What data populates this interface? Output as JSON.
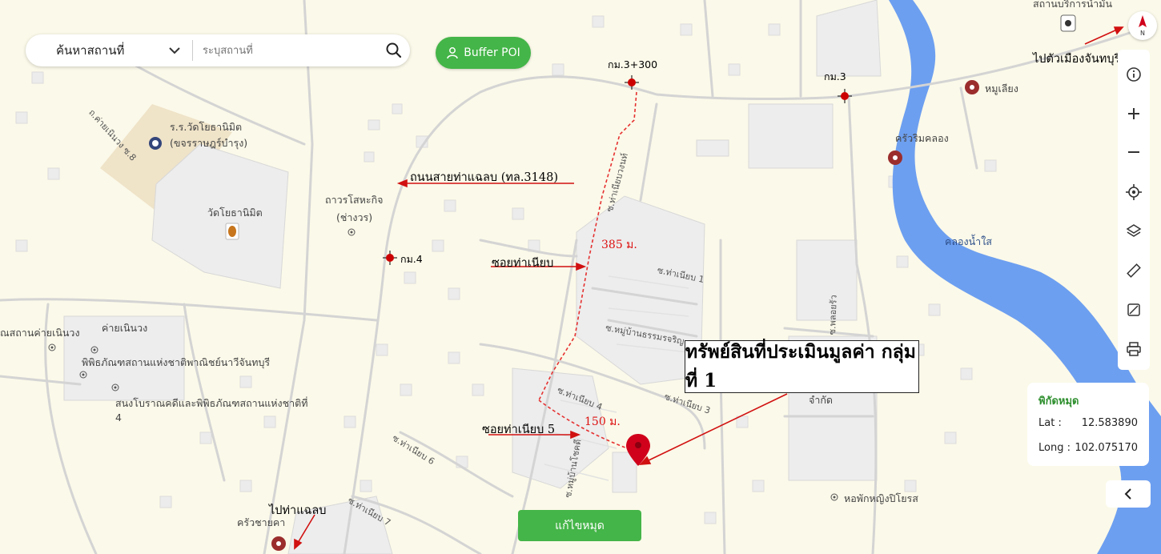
{
  "search": {
    "mode": "ค้นหาสถานที่",
    "placeholder": "ระบุสถานที่"
  },
  "buffer_button": {
    "label": "Buffer POI"
  },
  "callout": {
    "text": "ทรัพย์สินที่ประเมินมูลค่า กลุ่มที่ 1"
  },
  "annotations": {
    "main_road": "ถนนสายท่าแฉลบ (ทล.3148)",
    "soi": "ซอยท่าเนียบ",
    "soi5": "ซอยท่าเนียบ 5",
    "dist_385": "385 ม.",
    "dist_150": "150 ม.",
    "to_chanthaburi": "ไปตัวเมืองจันทบุรี",
    "to_thachalaep": "ไปท่าแฉลบ"
  },
  "km_markers": {
    "km3_300": "กม.3+300",
    "km3": "กม.3",
    "km4": "กม.4"
  },
  "places": {
    "school": "ร.ร.วัดโยธานิมิต",
    "school_sub": "(ขจรราษฎร์บำรุง)",
    "temple": "วัดโยธานิมิต",
    "thaworn": "ถาวรโสหะกิจ",
    "thaworn_sub": "(ช่างวร)",
    "camp": "ค่ายเนินวง",
    "camp_office": "ณสถานค่ายเนินวง",
    "museum": "พิพิธภัณฑสถานแห่งชาติพาณิชย์นาวีจันทบุรี",
    "archaeology": "สนงโบราณคดีและพิพิธภัณฑสถานแห่งชาติที่",
    "archaeology_num": "4",
    "noodle": "หมูเลียง",
    "riverside": "ครัวริมคลอง",
    "canal": "คลองน้ำใส",
    "company": "จำกัด",
    "dorm": "หอพักหญิงปิโยรส",
    "krua": "ครัวชายคา",
    "top_right": "สถานบริการน้ำมัน"
  },
  "roads": {
    "r1": "ถ.ค่ายเนินวง ซ.8",
    "r2": "ซ.ท่าเนียบ 1",
    "r3": "ซ.หมู่บ้านธรรมรจริญ",
    "r4": "ซ.ท่าเนียบ 4",
    "r5": "ซ.ท่าเนียบ 3",
    "r6": "ซ.ท่าเนียบ 6",
    "r7": "ซ.หมู่บ้านโชคดี",
    "r8": "ซ.ท่าเนียบ 7",
    "r9": "ซ.พลอยรัว",
    "r10": "ซ.ท่าเนียบวงนท์"
  },
  "coords": {
    "title": "พิกัดหมุด",
    "lat_label": "Lat :",
    "lat": "12.583890",
    "long_label": "Long :",
    "long": "102.075170"
  },
  "edit_button": {
    "label": "แก้ไขหมุด"
  },
  "colors": {
    "accent_green": "#44b548",
    "water": "#6d9ff0",
    "annotation_red": "#d11111",
    "marker_red": "#d0021b"
  }
}
